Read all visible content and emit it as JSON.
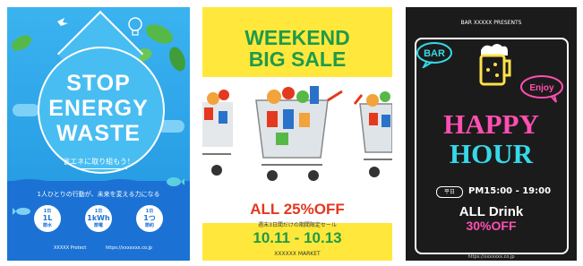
{
  "poster1": {
    "title": [
      "STOP",
      "ENERGY",
      "WASTE"
    ],
    "subtitle": "省エネに取り組もう！",
    "tagline": "1人ひとりの行動が、未来を変える力になる",
    "badges": [
      {
        "top": "1日",
        "main": "1L",
        "bottom": "節水"
      },
      {
        "top": "1日",
        "main": "1kWh",
        "bottom": "節電"
      },
      {
        "top": "1日",
        "main": "1つ",
        "bottom": "節約"
      }
    ],
    "footer_left": "XXXXX Protect",
    "footer_right": "https://xxxxxxx.co.jp",
    "colors": {
      "sky": "#2aa5ea",
      "sea": "#1c72d4",
      "leaf": "#56b947"
    }
  },
  "poster2": {
    "headline": [
      "WEEKEND",
      "BIG SALE"
    ],
    "discount": "ALL 25%OFF",
    "note": "週末3日間だけの期間限定セール",
    "dates": "10.11 - 10.13",
    "market": "XXXXXX MARKET",
    "colors": {
      "yellow": "#ffe83b",
      "green": "#1f9a4b",
      "red": "#e4381f"
    }
  },
  "poster3": {
    "presents": "BAR XXXXX PRESENTS",
    "bubble_left": "BAR",
    "bubble_right": "Enjoy",
    "headline": [
      "HAPPY",
      "HOUR"
    ],
    "day_label": "平日",
    "time": "PM15:00 - 19:00",
    "drink": "ALL Drink",
    "off": "30%OFF",
    "url": "https://xxxxxxx.co.jp",
    "colors": {
      "bg": "#1c1b1b",
      "pink": "#ff4fb2",
      "cyan": "#35d9e8",
      "yellow": "#ffe14a"
    }
  }
}
